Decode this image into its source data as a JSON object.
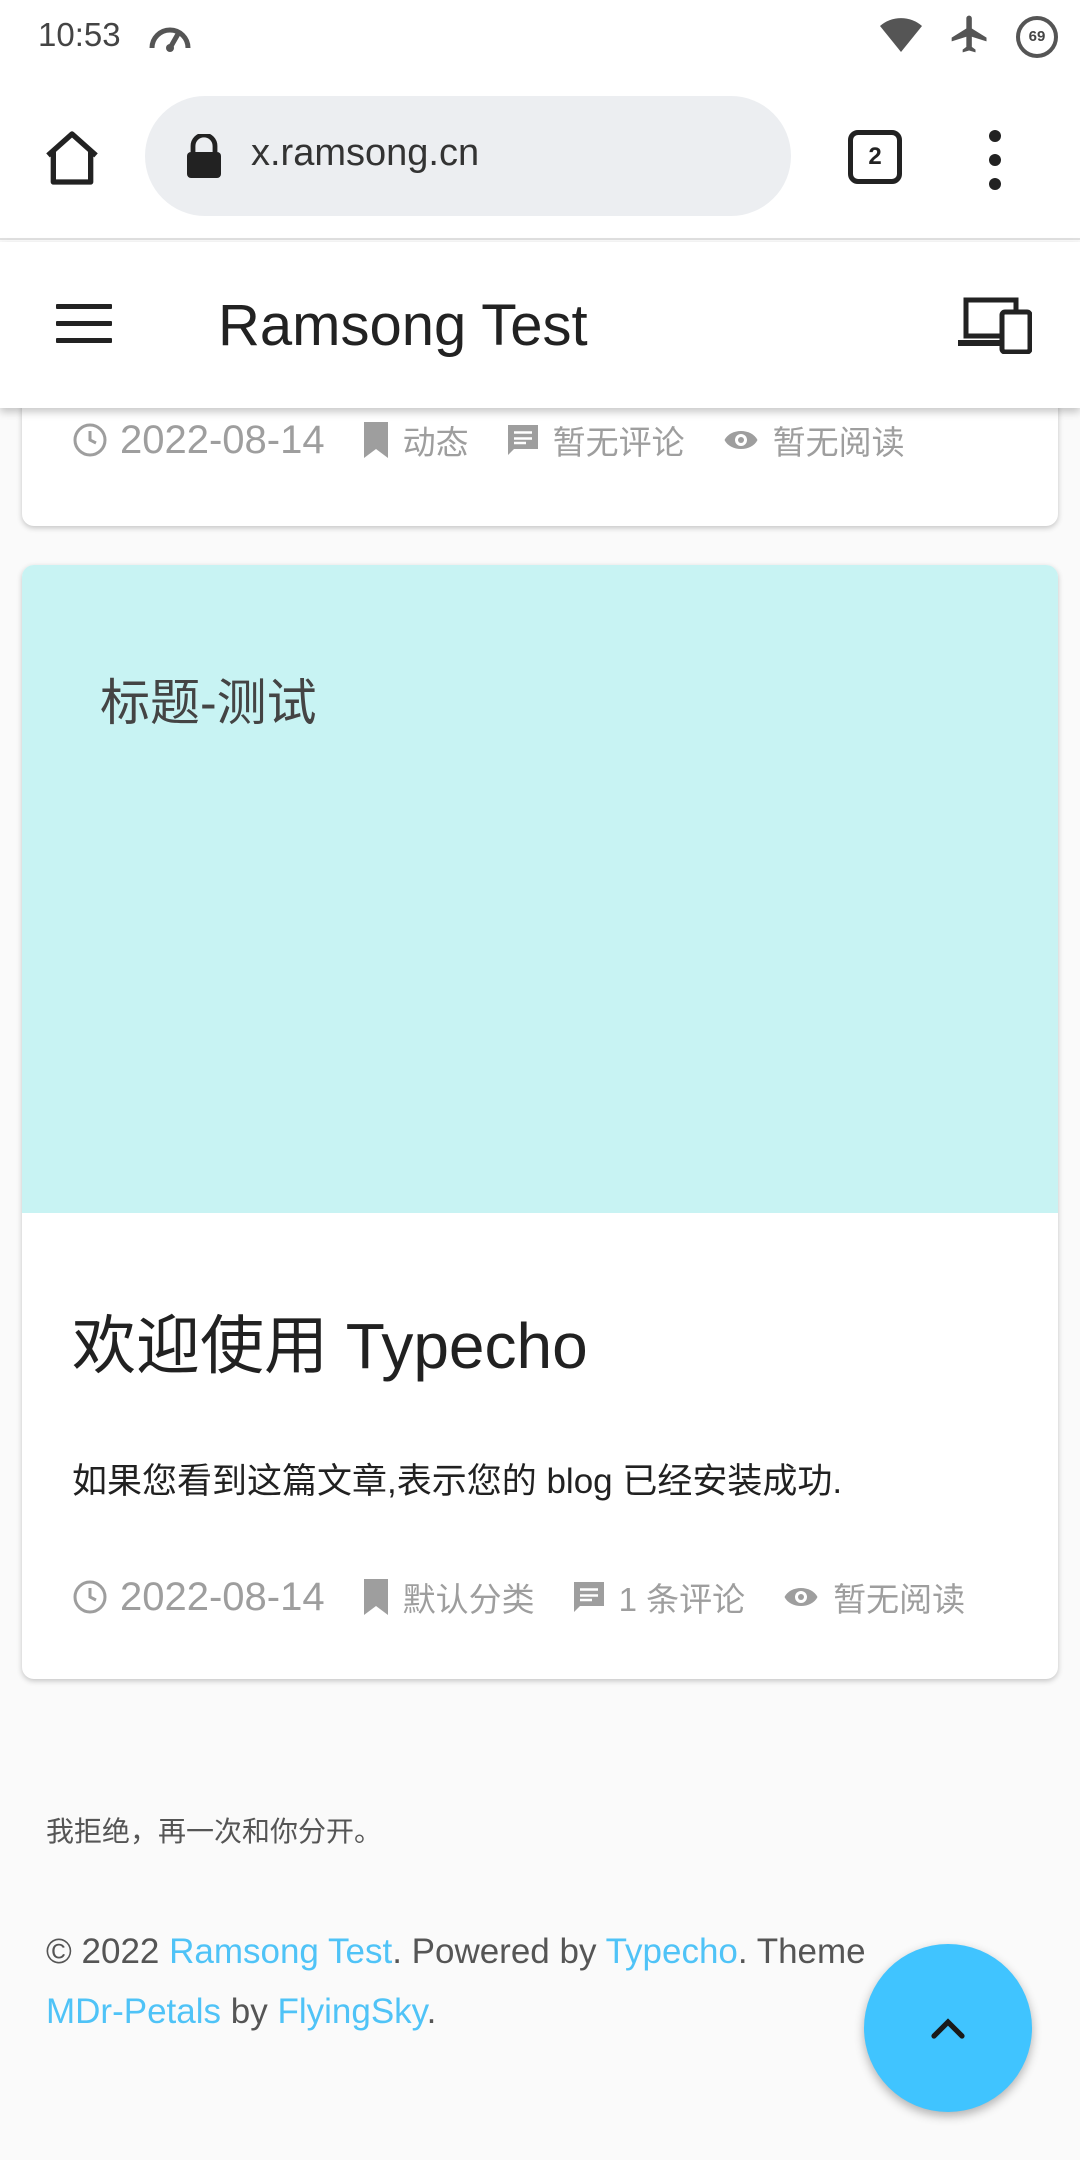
{
  "status_bar": {
    "time": "10:53",
    "battery_level": "69"
  },
  "browser": {
    "url": "x.ramsong.cn",
    "tab_count": "2"
  },
  "app_bar": {
    "title": "Ramsong Test"
  },
  "top_card_meta": {
    "date": "2022-08-14",
    "category": "动态",
    "comments": "暂无评论",
    "views": "暂无阅读"
  },
  "post": {
    "cover_title": "标题-测试",
    "title": "欢迎使用 Typecho",
    "excerpt": "如果您看到这篇文章,表示您的 blog 已经安装成功.",
    "date": "2022-08-14",
    "category": "默认分类",
    "comments": "1 条评论",
    "views": "暂无阅读"
  },
  "footer": {
    "quote": "我拒绝，再一次和你分开。",
    "copyright_prefix": "© 2022 ",
    "site_link": "Ramsong Test",
    "powered_by": ". Powered by ",
    "typecho_link": "Typecho",
    "theme_text": ". Theme ",
    "theme_link": "MDr-Petals",
    "by_text": " by ",
    "author_link": "FlyingSky",
    "end": "."
  },
  "colors": {
    "cover_bg": "#c8f3f3",
    "link": "#4fc3f7",
    "fab": "#40c4ff"
  },
  "icons": [
    "signal-speed-icon",
    "wifi-icon",
    "airplane-icon",
    "battery-icon",
    "home-icon",
    "lock-icon",
    "tabs-icon",
    "more-vert-icon",
    "menu-icon",
    "devices-icon",
    "clock-icon",
    "bookmark-icon",
    "comment-icon",
    "eye-icon",
    "chevron-up-icon"
  ]
}
